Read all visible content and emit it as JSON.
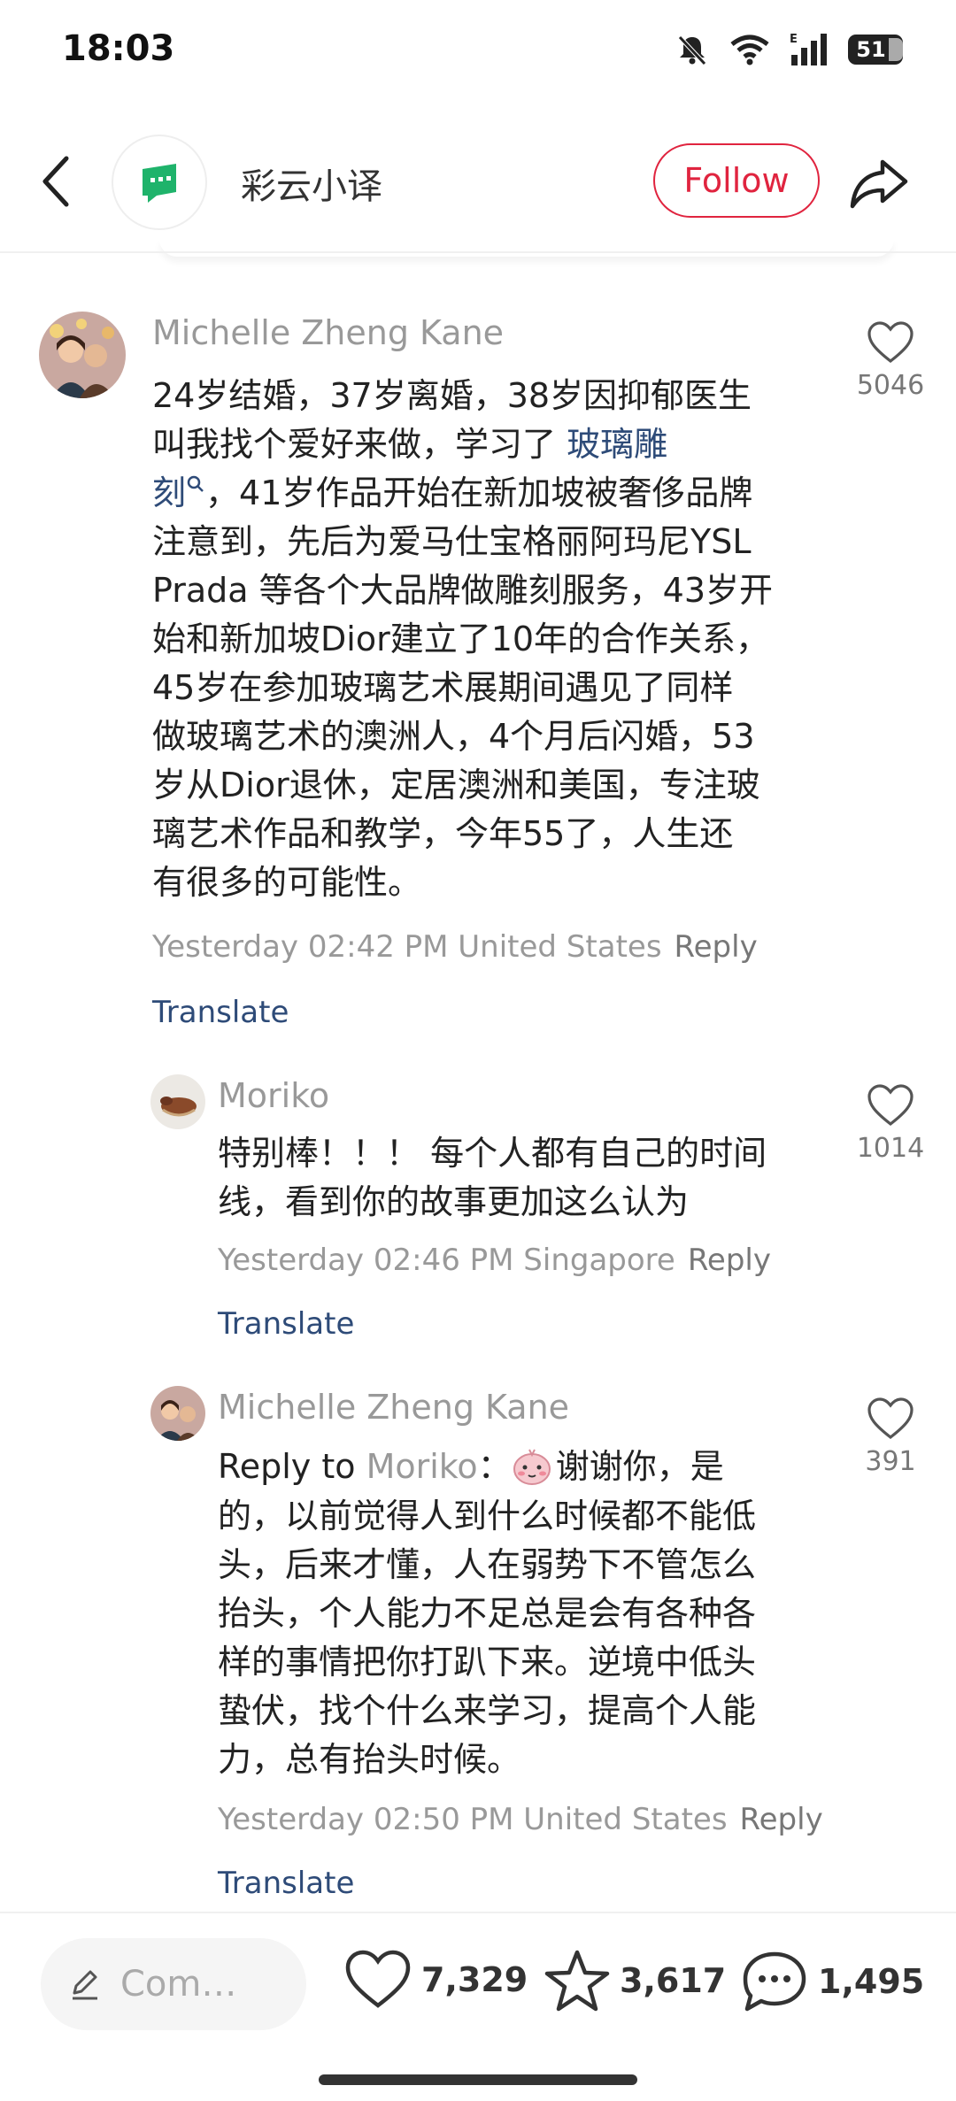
{
  "status_bar": {
    "time": "18:03",
    "battery_level": "51"
  },
  "header": {
    "author_name": "彩云小译",
    "follow_label": "Follow"
  },
  "comments": [
    {
      "author": "Michelle Zheng Kane",
      "body_lines": [
        "24岁结婚，37岁离婚，38岁因抑郁医生",
        "叫我找个爱好来做，学习了 ",
        "，41岁作品开始在新加坡被奢侈品牌",
        "注意到，先后为爱马仕宝格丽阿玛尼YSL",
        "Prada 等各个大品牌做雕刻服务，43岁开",
        "始和新加坡Dior建立了10年的合作关系，",
        "45岁在参加玻璃艺术展期间遇见了同样",
        "做玻璃艺术的澳洲人，4个月后闪婚，53",
        "岁从Dior退休，定居澳洲和美国，专注玻",
        "璃艺术作品和教学，今年55了，人生还",
        "有很多的可能性。"
      ],
      "tag_part1": "玻璃雕",
      "tag_part2": "刻",
      "meta": "Yesterday 02:42 PM United States",
      "reply_label": "Reply",
      "translate_label": "Translate",
      "likes": "5046"
    },
    {
      "author": "Moriko",
      "body_lines": [
        "特别棒！！！ 每个人都有自己的时间",
        "线，看到你的故事更加这么认为"
      ],
      "meta": "Yesterday 02:46 PM Singapore",
      "reply_label": "Reply",
      "translate_label": "Translate",
      "likes": "1014"
    },
    {
      "author": "Michelle Zheng Kane",
      "reply_prefix": "Reply to ",
      "reply_target": "Moriko",
      "reply_colon": "：",
      "first_line_text": "谢谢你，是",
      "body_lines": [
        "的，以前觉得人到什么时候都不能低",
        "头，后来才懂，人在弱势下不管怎么",
        "抬头，个人能力不足总是会有各种各",
        "样的事情把你打趴下来。逆境中低头",
        "蛰伏，找个什么来学习，提高个人能",
        "力，总有抬头时候。"
      ],
      "meta": "Yesterday 02:50 PM United States",
      "reply_label": "Reply",
      "translate_label": "Translate",
      "likes": "391"
    }
  ],
  "bottom_bar": {
    "comment_placeholder": "Com…",
    "likes": "7,329",
    "favorites": "3,617",
    "comments": "1,495"
  },
  "colors": {
    "accent": "#e0243f",
    "link": "#2e4b78",
    "app_green": "#1fb36b"
  },
  "icons": [
    "back-arrow-icon",
    "share-icon",
    "heart-icon",
    "star-icon",
    "chat-bubble-icon",
    "pencil-icon",
    "search-mini-icon",
    "mute-bell-icon",
    "wifi-icon",
    "signal-icon",
    "battery-icon"
  ]
}
